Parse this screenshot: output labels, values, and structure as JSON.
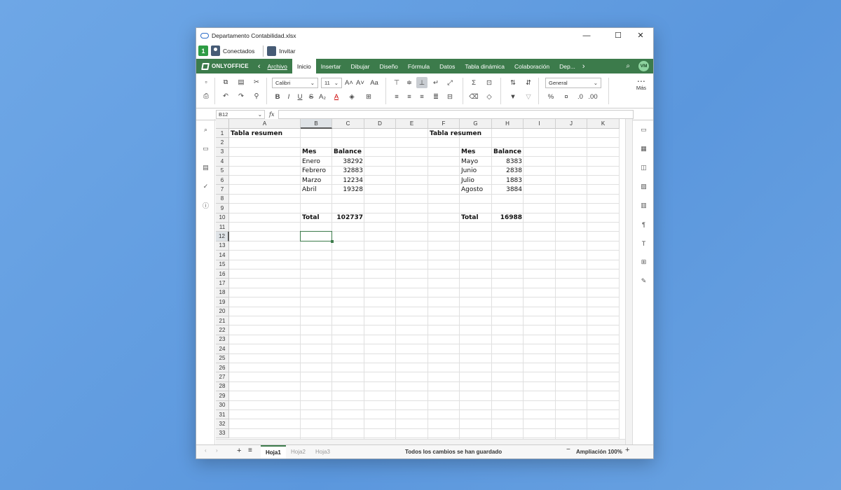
{
  "window": {
    "title": "Departamento Contabilidad.xlsx",
    "minimize": "—",
    "maximize": "☐",
    "close": "✕"
  },
  "userbar": {
    "count": "1",
    "connected": "Conectados",
    "invite": "Invitar"
  },
  "menu": {
    "logo": "ONLYOFFICE",
    "tabs": [
      "Archivo",
      "Inicio",
      "Insertar",
      "Dibujar",
      "Diseño",
      "Fórmula",
      "Datos",
      "Tabla dinámica",
      "Colaboración",
      "Dep..."
    ],
    "active_tab": "Inicio",
    "avatar": "VM"
  },
  "toolbar": {
    "font": "Calibri",
    "font_size": "11",
    "number_format": "General",
    "more": "Más"
  },
  "formula": {
    "cell_ref": "B12",
    "fx": "fx",
    "value": ""
  },
  "grid": {
    "columns": [
      "A",
      "B",
      "C",
      "D",
      "E",
      "F",
      "G",
      "H",
      "I",
      "J",
      "K"
    ],
    "rows": [
      "1",
      "2",
      "3",
      "4",
      "5",
      "6",
      "7",
      "8",
      "9",
      "10",
      "11",
      "12",
      "13",
      "14",
      "15",
      "16",
      "17",
      "18",
      "19",
      "20",
      "21",
      "22",
      "23",
      "24",
      "25",
      "26",
      "27",
      "28",
      "29",
      "30",
      "31",
      "32",
      "33"
    ],
    "selected": "B12",
    "cells": [
      {
        "ref": "A1",
        "text": "Tabla resumen",
        "bold": true
      },
      {
        "ref": "B3",
        "text": "Mes",
        "bold": true
      },
      {
        "ref": "C3",
        "text": "Balance",
        "bold": true
      },
      {
        "ref": "B4",
        "text": "Enero"
      },
      {
        "ref": "C4",
        "text": "38292",
        "num": true
      },
      {
        "ref": "B5",
        "text": "Febrero"
      },
      {
        "ref": "C5",
        "text": "32883",
        "num": true
      },
      {
        "ref": "B6",
        "text": "Marzo"
      },
      {
        "ref": "C6",
        "text": "12234",
        "num": true
      },
      {
        "ref": "B7",
        "text": "Abril"
      },
      {
        "ref": "C7",
        "text": "19328",
        "num": true
      },
      {
        "ref": "B10",
        "text": "Total",
        "bold": true
      },
      {
        "ref": "C10",
        "text": "102737",
        "bold": true,
        "num": true
      },
      {
        "ref": "F1",
        "text": "Tabla resumen",
        "bold": true
      },
      {
        "ref": "G3",
        "text": "Mes",
        "bold": true
      },
      {
        "ref": "H3",
        "text": "Balance",
        "bold": true
      },
      {
        "ref": "G4",
        "text": "Mayo"
      },
      {
        "ref": "H4",
        "text": "8383",
        "num": true
      },
      {
        "ref": "G5",
        "text": "Junio"
      },
      {
        "ref": "H5",
        "text": "2838",
        "num": true
      },
      {
        "ref": "G6",
        "text": "Julio"
      },
      {
        "ref": "H6",
        "text": "1883",
        "num": true
      },
      {
        "ref": "G7",
        "text": "Agosto"
      },
      {
        "ref": "H7",
        "text": "3884",
        "num": true
      },
      {
        "ref": "G10",
        "text": "Total",
        "bold": true
      },
      {
        "ref": "H10",
        "text": "16988",
        "bold": true,
        "num": true
      }
    ]
  },
  "status": {
    "sheets": [
      "Hoja1",
      "Hoja2",
      "Hoja3"
    ],
    "active_sheet": "Hoja1",
    "message": "Todos los cambios se han guardado",
    "zoom": "Ampliación 100%"
  }
}
